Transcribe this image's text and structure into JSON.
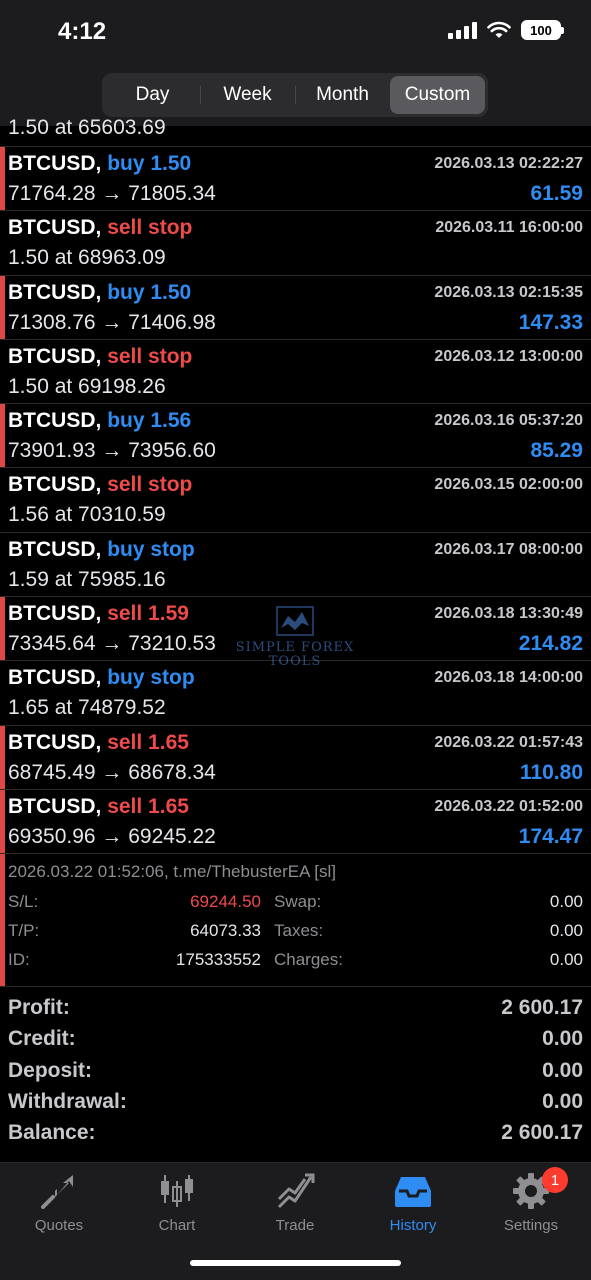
{
  "status": {
    "time": "4:12",
    "battery": "100"
  },
  "segments": [
    {
      "label": "Day",
      "active": false
    },
    {
      "label": "Week",
      "active": false
    },
    {
      "label": "Month",
      "active": false
    },
    {
      "label": "Custom",
      "active": true
    }
  ],
  "partial_row": {
    "line2": "1.50 at 65603.69"
  },
  "deals": [
    {
      "symbol": "BTCUSD,",
      "action": "buy 1.50",
      "side": "buy",
      "time": "2026.03.13 02:22:27",
      "line2": "71764.28 → 71805.34",
      "profit": "61.59",
      "bar": true
    },
    {
      "symbol": "BTCUSD,",
      "action": "sell stop",
      "side": "sell",
      "time": "2026.03.11 16:00:00",
      "line2": "1.50 at 68963.09",
      "profit": "",
      "bar": false
    },
    {
      "symbol": "BTCUSD,",
      "action": "buy 1.50",
      "side": "buy",
      "time": "2026.03.13 02:15:35",
      "line2": "71308.76 → 71406.98",
      "profit": "147.33",
      "bar": true
    },
    {
      "symbol": "BTCUSD,",
      "action": "sell stop",
      "side": "sell",
      "time": "2026.03.12 13:00:00",
      "line2": "1.50 at 69198.26",
      "profit": "",
      "bar": false
    },
    {
      "symbol": "BTCUSD,",
      "action": "buy 1.56",
      "side": "buy",
      "time": "2026.03.16 05:37:20",
      "line2": "73901.93 → 73956.60",
      "profit": "85.29",
      "bar": true
    },
    {
      "symbol": "BTCUSD,",
      "action": "sell stop",
      "side": "sell",
      "time": "2026.03.15 02:00:00",
      "line2": "1.56 at 70310.59",
      "profit": "",
      "bar": false
    },
    {
      "symbol": "BTCUSD,",
      "action": "buy stop",
      "side": "buy",
      "time": "2026.03.17 08:00:00",
      "line2": "1.59 at 75985.16",
      "profit": "",
      "bar": false
    },
    {
      "symbol": "BTCUSD,",
      "action": "sell 1.59",
      "side": "sell",
      "time": "2026.03.18 13:30:49",
      "line2": "73345.64 → 73210.53",
      "profit": "214.82",
      "bar": true
    },
    {
      "symbol": "BTCUSD,",
      "action": "buy stop",
      "side": "buy",
      "time": "2026.03.18 14:00:00",
      "line2": "1.65 at 74879.52",
      "profit": "",
      "bar": false
    },
    {
      "symbol": "BTCUSD,",
      "action": "sell 1.65",
      "side": "sell",
      "time": "2026.03.22 01:57:43",
      "line2": "68745.49 → 68678.34",
      "profit": "110.80",
      "bar": true
    },
    {
      "symbol": "BTCUSD,",
      "action": "sell 1.65",
      "side": "sell",
      "time": "2026.03.22 01:52:00",
      "line2": "69350.96 → 69245.22",
      "profit": "174.47",
      "bar": true
    }
  ],
  "detail": {
    "comment": "2026.03.22 01:52:06, t.me/ThebusterEA [sl]",
    "sl_label": "S/L:",
    "sl_value": "69244.50",
    "tp_label": "T/P:",
    "tp_value": "64073.33",
    "id_label": "ID:",
    "id_value": "175333552",
    "swap_label": "Swap:",
    "swap_value": "0.00",
    "taxes_label": "Taxes:",
    "taxes_value": "0.00",
    "charges_label": "Charges:",
    "charges_value": "0.00"
  },
  "summary": [
    {
      "label": "Profit:",
      "value": "2 600.17"
    },
    {
      "label": "Credit:",
      "value": "0.00"
    },
    {
      "label": "Deposit:",
      "value": "0.00"
    },
    {
      "label": "Withdrawal:",
      "value": "0.00"
    },
    {
      "label": "Balance:",
      "value": "2 600.17"
    }
  ],
  "watermark": {
    "line1": "SIMPLE FOREX",
    "line2": "TOOLS"
  },
  "tabs": [
    {
      "label": "Quotes",
      "icon": "quotes-icon",
      "active": false
    },
    {
      "label": "Chart",
      "icon": "chart-icon",
      "active": false
    },
    {
      "label": "Trade",
      "icon": "trade-icon",
      "active": false
    },
    {
      "label": "History",
      "icon": "history-icon",
      "active": true
    },
    {
      "label": "Settings",
      "icon": "settings-icon",
      "active": false,
      "badge": "1"
    }
  ],
  "colors": {
    "buy": "#2f8cf3",
    "sell": "#ef4a4a",
    "bar": "#e04848",
    "accent": "#2f8cf3"
  }
}
